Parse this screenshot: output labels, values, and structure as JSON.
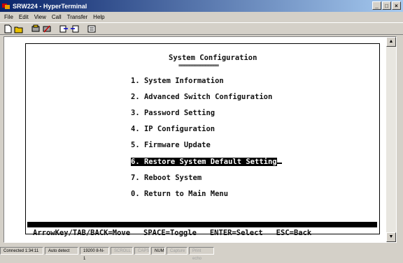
{
  "window": {
    "title": "SRW224 - HyperTerminal",
    "controls": [
      "_",
      "□",
      "×"
    ]
  },
  "menu": [
    "File",
    "Edit",
    "View",
    "Call",
    "Transfer",
    "Help"
  ],
  "toolbar_icons": [
    "new-icon",
    "open-icon",
    "call-icon",
    "disconnect-icon",
    "send-icon",
    "receive-icon",
    "properties-icon"
  ],
  "terminal": {
    "heading": "System Configuration",
    "heading_underline": "===============",
    "items": [
      {
        "label": "1. System Information"
      },
      {
        "label": "2. Advanced Switch Configuration"
      },
      {
        "label": "3. Password Setting"
      },
      {
        "label": "4. IP Configuration"
      },
      {
        "label": "5. Firmware Update"
      },
      {
        "label": "6. Restore System Default Setting",
        "selected": true
      },
      {
        "label": "7. Reboot System"
      },
      {
        "label": "0. Return to Main Menu"
      }
    ],
    "footer": "ArrowKey/TAB/BACK=Move   SPACE=Toggle   ENTER=Select   ESC=Back"
  },
  "status": {
    "connected": "Connected 1:34:11",
    "detect": "Auto detect",
    "settings": "19200 8-N-1",
    "scroll": "SCROLL",
    "caps": "CAPS",
    "num": "NUM",
    "capture": "Capture",
    "print_echo": "Print echo"
  }
}
